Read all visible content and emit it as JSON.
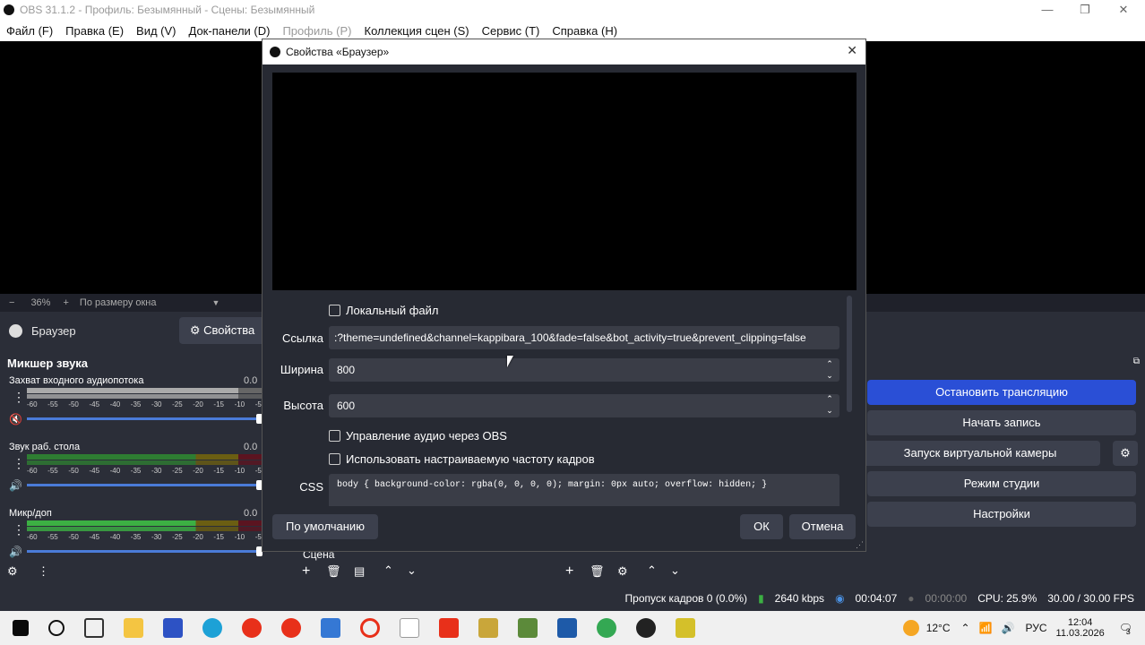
{
  "window": {
    "title": "OBS 31.1.2 - Профиль: Безымянный - Сцены: Безымянный"
  },
  "menu": [
    {
      "label": "Файл (F)",
      "disabled": false
    },
    {
      "label": "Правка (E)",
      "disabled": false
    },
    {
      "label": "Вид (V)",
      "disabled": false
    },
    {
      "label": "Док-панели (D)",
      "disabled": false
    },
    {
      "label": "Профиль (P)",
      "disabled": true
    },
    {
      "label": "Коллекция сцен (S)",
      "disabled": false
    },
    {
      "label": "Сервис (T)",
      "disabled": false
    },
    {
      "label": "Справка (H)",
      "disabled": false
    }
  ],
  "zoom": {
    "minus": "−",
    "value": "36%",
    "plus": "+",
    "mode": "По размеру окна"
  },
  "source": {
    "name": "Браузер",
    "properties_label": "Свойства"
  },
  "mixer": {
    "title": "Микшер звука",
    "scale": [
      "-60",
      "-55",
      "-50",
      "-45",
      "-40",
      "-35",
      "-30",
      "-25",
      "-20",
      "-15",
      "-10",
      "-5"
    ],
    "tracks": [
      {
        "name": "Захват входного аудиопотока",
        "db": "0.0"
      },
      {
        "name": "Звук раб. стола",
        "db": "0.0"
      },
      {
        "name": "Микр/доп",
        "db": "0.0"
      }
    ]
  },
  "scene_label": "Сцена",
  "dialog": {
    "title": "Свойства «Браузер»",
    "local_file": "Локальный файл",
    "url_label": "Ссылка",
    "url_value": ":?theme=undefined&channel=kappibara_100&fade=false&bot_activity=true&prevent_clipping=false",
    "width_label": "Ширина",
    "width_value": "800",
    "height_label": "Высота",
    "height_value": "600",
    "audio_control": "Управление аудио через OBS",
    "custom_fps": "Использовать настраиваемую частоту кадров",
    "css_label": "CSS",
    "css_value": "body { background-color: rgba(0, 0, 0, 0); margin: 0px auto; overflow: hidden; }",
    "defaults_button": "По умолчанию",
    "ok_button": "ОК",
    "cancel_button": "Отмена"
  },
  "controls": {
    "stop_stream": "Остановить трансляцию",
    "start_record": "Начать запись",
    "virtual_cam": "Запуск виртуальной камеры",
    "studio_mode": "Режим студии",
    "settings": "Настройки"
  },
  "status": {
    "dropped": "Пропуск кадров 0 (0.0%)",
    "bitrate": "2640 kbps",
    "stream_time": "00:04:07",
    "rec_time": "00:00:00",
    "cpu": "CPU: 25.9%",
    "fps": "30.00 / 30.00 FPS"
  },
  "taskbar": {
    "weather": "12°C",
    "lang": "РУС",
    "time": "12:04",
    "date": "11.03.2026",
    "notifications": "3"
  },
  "colors": {
    "accent": "#2a4fd6",
    "panel": "#2b2e38",
    "meter_green": "#3cb043",
    "meter_yellow": "#b59a1a",
    "meter_red": "#8b1a2a"
  }
}
